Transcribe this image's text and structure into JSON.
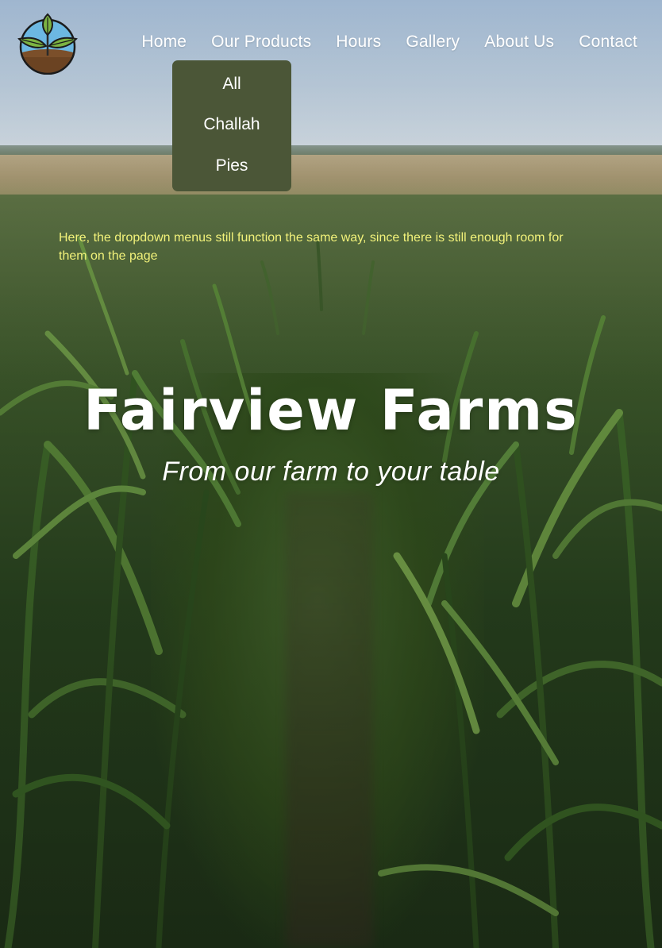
{
  "header": {
    "logo_icon": "plant-sprout-logo-icon",
    "nav": [
      {
        "id": "home",
        "label": "Home"
      },
      {
        "id": "our-products",
        "label": "Our Products"
      },
      {
        "id": "hours",
        "label": "Hours"
      },
      {
        "id": "gallery",
        "label": "Gallery"
      },
      {
        "id": "about-us",
        "label": "About Us"
      },
      {
        "id": "contact",
        "label": "Contact"
      }
    ],
    "dropdown": {
      "parent": "Our Products",
      "items": [
        "All",
        "Challah",
        "Pies"
      ]
    }
  },
  "note": "Here, the dropdown menus still function the same way, since there is still enough room for them on the page",
  "hero": {
    "title": "Fairview Farms",
    "subtitle": "From our farm to your table"
  },
  "colors": {
    "dropdown_bg": "#4b5637",
    "note_text": "#f2f27a",
    "nav_text": "#ffffff"
  }
}
